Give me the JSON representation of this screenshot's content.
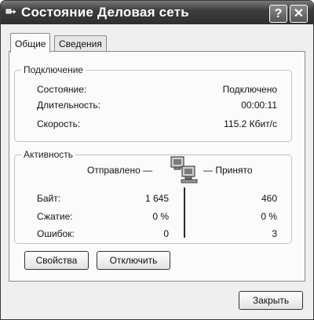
{
  "window": {
    "title": "Состояние Деловая сеть"
  },
  "titlebar": {
    "help_glyph": "?",
    "close_glyph": "✕"
  },
  "tabs": [
    {
      "label": "Общие"
    },
    {
      "label": "Сведения"
    }
  ],
  "connection": {
    "group_title": "Подключение",
    "rows": [
      {
        "label": "Состояние:",
        "value": "Подключено"
      },
      {
        "label": "Длительность:",
        "value": "00:00:11"
      },
      {
        "label": "Скорость:",
        "value": "115.2 Кбит/с"
      }
    ]
  },
  "activity": {
    "group_title": "Активность",
    "sent_label": "Отправлено —",
    "received_label": "— Принято",
    "rows": [
      {
        "label": "Байт:",
        "sent": "1 645",
        "received": "460"
      },
      {
        "label": "Сжатие:",
        "sent": "0 %",
        "received": "0 %"
      },
      {
        "label": "Ошибок:",
        "sent": "0",
        "received": "3"
      }
    ]
  },
  "buttons": {
    "properties": "Свойства",
    "disconnect": "Отключить",
    "close": "Закрыть"
  },
  "icons": {
    "title": "network-connection-icon",
    "activity": "network-computers-icon"
  }
}
